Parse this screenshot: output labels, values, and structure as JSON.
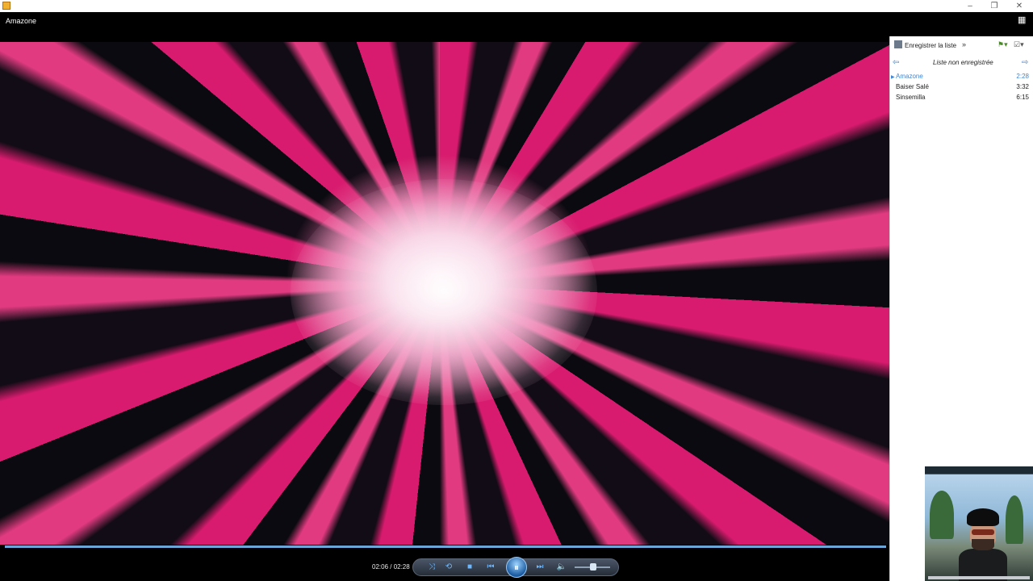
{
  "window": {
    "minimize": "–",
    "restore": "❐",
    "close": "✕"
  },
  "now_playing": {
    "title": "Amazone"
  },
  "playback": {
    "time": "02:06 / 02:28",
    "progress": 0.993,
    "volume": 0.45
  },
  "controls": {
    "shuffle": "⤨",
    "repeat": "⟲",
    "stop": "■",
    "previous": "⏮",
    "play_pause": "⏸",
    "next": "⏭",
    "mute": "🔈"
  },
  "playlist": {
    "save_label": "Enregistrer la liste",
    "more": "»",
    "name": "Liste non enregistrée",
    "items": [
      {
        "title": "Amazone",
        "duration": "2:28",
        "active": true
      },
      {
        "title": "Baiser Salé",
        "duration": "3:32",
        "active": false
      },
      {
        "title": "Sinsemilla",
        "duration": "6:15",
        "active": false
      }
    ]
  },
  "colors": {
    "accent": "#3f86d8",
    "video_primary": "#d81b6e",
    "seekbar": "#6aa7d8"
  }
}
